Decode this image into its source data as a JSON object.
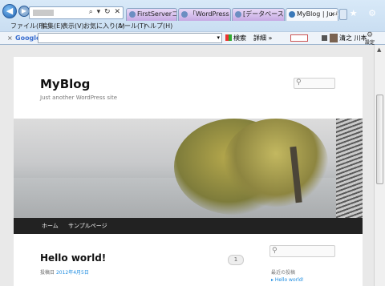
{
  "browser": {
    "back_icon": "back-arrow-icon",
    "forward_icon": "forward-arrow-icon",
    "address_controls": "⌕ ▾ ↻ ✕",
    "tabs": [
      {
        "label": "FirstServerコンプ..."
      },
      {
        "label": "「WordPress 3.x..."
      },
      {
        "label": "[データベースの設..."
      },
      {
        "label": "MyBlog | Just ..."
      }
    ],
    "right_icons": "⌂ ★ ⚙"
  },
  "menu": {
    "items": [
      "ファイル(F)",
      "編集(E)",
      "表示(V)",
      "お気に入り(A)",
      "ツール(T)",
      "ヘルプ(H)"
    ]
  },
  "toolbar": {
    "close": "×",
    "google": "Google",
    "search_btn": "検索",
    "more": "詳細 »",
    "user": "清之 川本",
    "settings": "設定"
  },
  "site": {
    "title": "MyBlog",
    "description": "Just another WordPress site",
    "nav": [
      "ホーム",
      "サンプルページ"
    ],
    "post": {
      "title": "Hello world!",
      "meta_prefix": "投稿日",
      "date": "2012年4月5日",
      "comment_count": "1"
    },
    "sidebar": {
      "recent_heading": "最近の投稿",
      "recent_link": "Hello world!"
    }
  },
  "colors": {
    "nav_bg": "#222222",
    "link": "#1b8be0"
  }
}
